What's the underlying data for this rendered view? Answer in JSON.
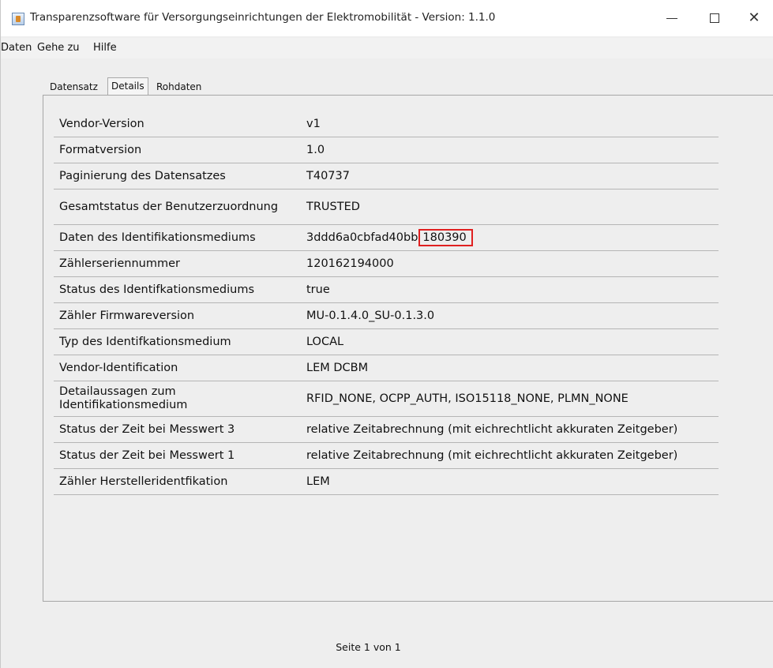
{
  "window": {
    "title": "Transparenzsoftware für Versorgungseinrichtungen der Elektromobilität - Version: 1.1.0",
    "icon": "java-app-icon"
  },
  "menu": [
    "Daten",
    "Gehe zu",
    "Hilfe"
  ],
  "tabs": [
    {
      "label": "Datensatz",
      "active": false
    },
    {
      "label": "Details",
      "active": true
    },
    {
      "label": "Rohdaten",
      "active": false
    }
  ],
  "details": [
    {
      "label": "Vendor-Version",
      "value": "v1"
    },
    {
      "label": "Formatversion",
      "value": "1.0"
    },
    {
      "label": "Paginierung des Datensatzes",
      "value": "T40737"
    },
    {
      "label": "Gesamtstatus der Benutzerzuordnung",
      "value": "TRUSTED"
    },
    {
      "label": "Daten des Identifikationsmediums",
      "value": "3ddd6a0cbfad40bb",
      "highlight": "180390"
    },
    {
      "label": "Zählerseriennummer",
      "value": "120162194000"
    },
    {
      "label": "Status des Identifkationsmediums",
      "value": "true"
    },
    {
      "label": "Zähler Firmwareversion",
      "value": "MU-0.1.4.0_SU-0.1.3.0"
    },
    {
      "label": "Typ des Identifkationsmedium",
      "value": "LOCAL"
    },
    {
      "label": "Vendor-Identification",
      "value": "LEM DCBM"
    },
    {
      "label": "Detailaussagen zum Identifikationsmedium",
      "value": "RFID_NONE, OCPP_AUTH, ISO15118_NONE, PLMN_NONE"
    },
    {
      "label": "Status der Zeit bei Messwert 3",
      "value": "relative Zeitabrechnung (mit eichrechtlicht akkuraten Zeitgeber)"
    },
    {
      "label": "Status der Zeit bei Messwert 1",
      "value": "relative Zeitabrechnung (mit eichrechtlicht akkuraten Zeitgeber)"
    },
    {
      "label": "Zähler Herstelleridentfikation",
      "value": "LEM"
    }
  ],
  "footer": {
    "pagination": "Seite 1 von 1"
  },
  "colors": {
    "highlight_border": "#e02020",
    "row_divider": "#b5b5b5"
  }
}
